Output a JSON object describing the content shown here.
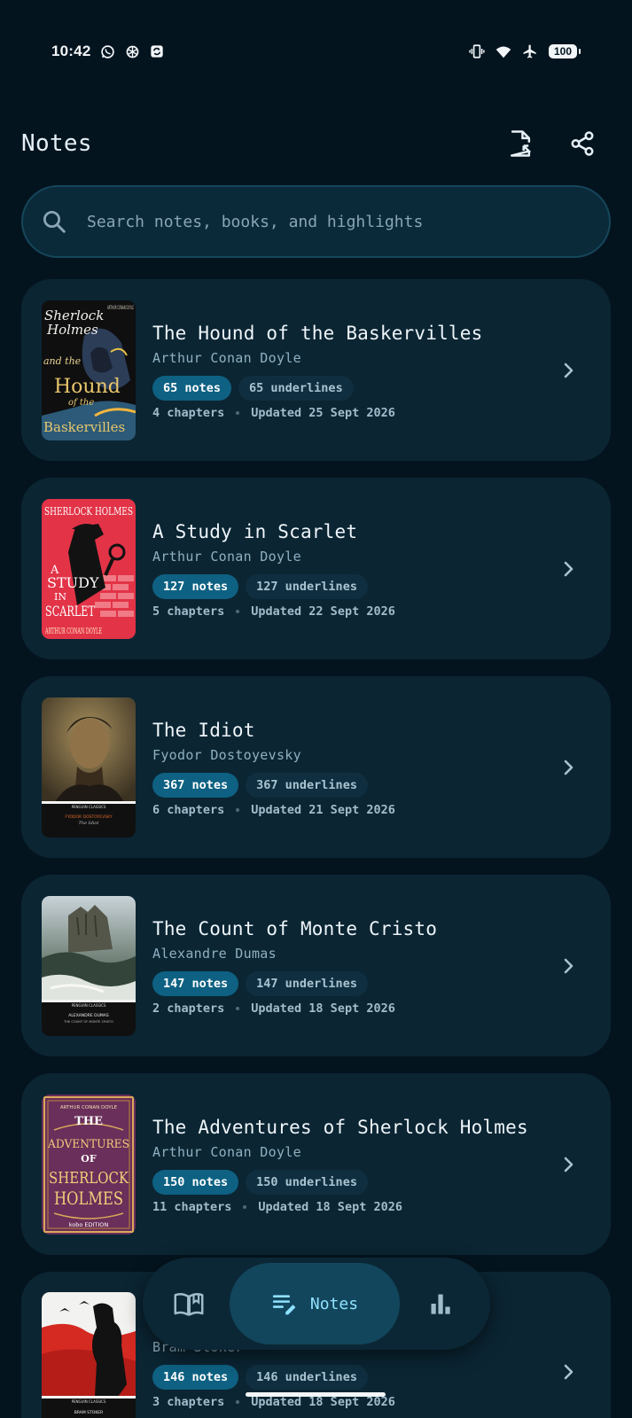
{
  "status_bar": {
    "time": "10:42",
    "battery": "100"
  },
  "header": {
    "title": "Notes"
  },
  "search": {
    "placeholder": "Search notes, books, and highlights"
  },
  "books": [
    {
      "title": "The Hound of the Baskervilles",
      "author": "Arthur Conan Doyle",
      "notes": "65 notes",
      "underlines": "65 underlines",
      "chapters": "4 chapters",
      "updated": "Updated 25 Sept 2026",
      "cover_lines": [
        "Sherlock",
        "Holmes",
        "and the",
        "Hound",
        "of the",
        "Baskervilles"
      ],
      "cover_corner": "ARTHUR CONAN DOYLE"
    },
    {
      "title": "A Study in Scarlet",
      "author": "Arthur Conan Doyle",
      "notes": "127 notes",
      "underlines": "127 underlines",
      "chapters": "5 chapters",
      "updated": "Updated 22 Sept 2026",
      "cover_top": "SHERLOCK HOLMES",
      "cover_lines": [
        "A",
        "STUDY",
        "IN",
        "SCARLET"
      ],
      "cover_bottom": "ARTHUR CONAN DOYLE"
    },
    {
      "title": "The Idiot",
      "author": "Fyodor Dostoyevsky",
      "notes": "367 notes",
      "underlines": "367 underlines",
      "chapters": "6 chapters",
      "updated": "Updated 21 Sept 2026",
      "cover_series": "PENGUIN CLASSICS",
      "cover_author": "FYODOR DOSTOYEVSKY",
      "cover_title": "The Idiot"
    },
    {
      "title": "The Count of Monte Cristo",
      "author": "Alexandre Dumas",
      "notes": "147 notes",
      "underlines": "147 underlines",
      "chapters": "2 chapters",
      "updated": "Updated 18 Sept 2026",
      "cover_series": "PENGUIN CLASSICS",
      "cover_author": "ALEXANDRE DUMAS",
      "cover_title": "THE COUNT OF MONTE CRISTO"
    },
    {
      "title": "The Adventures of Sherlock Holmes",
      "author": "Arthur Conan Doyle",
      "notes": "150 notes",
      "underlines": "150 underlines",
      "chapters": "11 chapters",
      "updated": "Updated 18 Sept 2026",
      "cover_top": "ARTHUR CONAN DOYLE",
      "cover_lines": [
        "THE",
        "ADVENTURES",
        "OF",
        "SHERLOCK",
        "HOLMES"
      ],
      "cover_bottom": "kobo EDITION"
    },
    {
      "title": "",
      "author": "Bram Stoker",
      "notes": "146 notes",
      "underlines": "146 underlines",
      "chapters": "3 chapters",
      "updated": "Updated 18 Sept 2026",
      "cover_series": "PENGUIN CLASSICS",
      "cover_author": "BRAM STOKER"
    }
  ],
  "nav": {
    "notes_label": "Notes"
  },
  "colors": {
    "background": "#04141f",
    "card": "#0b2533",
    "accent": "#0e6182",
    "nav_active": "#12465c",
    "nav_active_text": "#8fe2ff"
  }
}
